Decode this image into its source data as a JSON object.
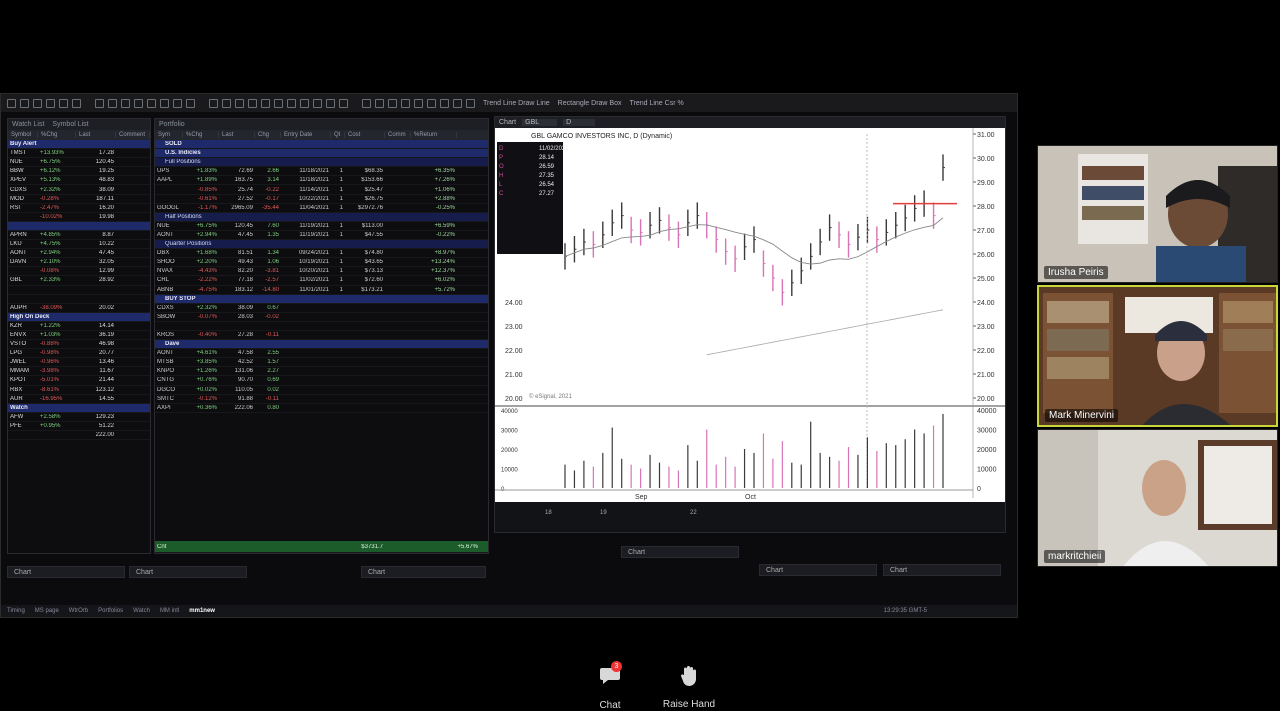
{
  "toolbar": {
    "tools": [
      "Trend Line Draw Line",
      "Rectangle Draw Box",
      "Trend Line Csr %"
    ]
  },
  "watchlist": {
    "tabs": [
      "Watch List",
      "Symbol List",
      "Portfolio"
    ],
    "columns": [
      "Symbol",
      "%Chg",
      "Last",
      "Comment"
    ],
    "groups": [
      {
        "title": "Buy Alert",
        "rows": [
          {
            "sym": "TMST",
            "pct": "+13.93%",
            "last": "17.28",
            "dir": "pos"
          },
          {
            "sym": "NUE",
            "pct": "+6.75%",
            "last": "120.45",
            "dir": "pos"
          },
          {
            "sym": "BBW",
            "pct": "+6.12%",
            "last": "19.25",
            "dir": "pos"
          },
          {
            "sym": "XPEV",
            "pct": "+5.13%",
            "last": "48.83",
            "dir": "pos"
          },
          {
            "sym": "CDXS",
            "pct": "+2.32%",
            "last": "38.09",
            "dir": "pos"
          },
          {
            "sym": "MOD",
            "pct": "-0.28%",
            "last": "187.11",
            "dir": "neg"
          },
          {
            "sym": "RSI",
            "pct": "-2.47%",
            "last": "16.20",
            "dir": "neg"
          },
          {
            "sym": "",
            "pct": "-10.02%",
            "last": "19.98",
            "dir": "neg"
          }
        ]
      },
      {
        "title": "",
        "rows": [
          {
            "sym": "APRN",
            "pct": "+4.85%",
            "last": "8.87",
            "dir": "pos"
          },
          {
            "sym": "LKU",
            "pct": "+4.75%",
            "last": "10.22",
            "dir": "pos"
          },
          {
            "sym": "AONT",
            "pct": "+2.94%",
            "last": "47.45",
            "dir": "pos"
          },
          {
            "sym": "DAVN",
            "pct": "+2.10%",
            "last": "32.05",
            "dir": "pos"
          },
          {
            "sym": "",
            "pct": "-0.08%",
            "last": "12.99",
            "dir": "neg"
          },
          {
            "sym": "GBL",
            "pct": "+2.33%",
            "last": "28.92",
            "dir": "pos"
          },
          {
            "sym": "",
            "pct": "",
            "last": "",
            "dir": "pos"
          },
          {
            "sym": "",
            "pct": "",
            "last": "",
            "dir": "pos"
          },
          {
            "sym": "AUPH",
            "pct": "-38.09%",
            "last": "20.02",
            "dir": "neg"
          }
        ]
      },
      {
        "title": "High On Deck",
        "rows": [
          {
            "sym": "KZR",
            "pct": "+1.22%",
            "last": "14.14",
            "dir": "pos"
          },
          {
            "sym": "ENVX",
            "pct": "+1.03%",
            "last": "36.19",
            "dir": "pos"
          },
          {
            "sym": "VSTO",
            "pct": "-0.88%",
            "last": "46.98",
            "dir": "neg"
          },
          {
            "sym": "LPG",
            "pct": "-0.98%",
            "last": "20.77",
            "dir": "neg"
          },
          {
            "sym": "JWEL",
            "pct": "-0.96%",
            "last": "13.46",
            "dir": "neg"
          },
          {
            "sym": "MMAM",
            "pct": "-3.98%",
            "last": "11.67",
            "dir": "neg"
          },
          {
            "sym": "KPOT",
            "pct": "-5.01%",
            "last": "21.44",
            "dir": "neg"
          },
          {
            "sym": "RBX",
            "pct": "-8.61%",
            "last": "123.12",
            "dir": "neg"
          },
          {
            "sym": "AUR",
            "pct": "-16.95%",
            "last": "14.55",
            "dir": "neg"
          }
        ]
      },
      {
        "title": "Watch",
        "rows": [
          {
            "sym": "AFW",
            "pct": "+2.58%",
            "last": "129.23",
            "dir": "pos"
          },
          {
            "sym": "PFE",
            "pct": "+0.95%",
            "last": "51.22",
            "dir": "pos"
          },
          {
            "sym": "",
            "pct": "",
            "last": "222.00",
            "dir": "pos"
          }
        ]
      }
    ]
  },
  "portfolio": {
    "columns": [
      "Sym",
      "%Chg",
      "Last",
      "Chg",
      "Entry Date",
      "Qt",
      "Cost",
      "Comm",
      "%Return"
    ],
    "sections": [
      {
        "title": "SOLD",
        "kind": "section",
        "rows": []
      },
      {
        "title": "U.S. Indicies",
        "kind": "section",
        "rows": []
      },
      {
        "title": "Full Positions",
        "kind": "subsection",
        "rows": [
          {
            "sym": "UPS",
            "pct": "+1.83%",
            "last": "72.69",
            "chg": "2.66",
            "date": "11/18/2021",
            "qty": "1",
            "cost": "$68.35",
            "ret": "+6.35%",
            "dir": "pos"
          },
          {
            "sym": "AAPL",
            "pct": "+1.89%",
            "last": "163.75",
            "chg": "3.14",
            "date": "11/18/2021",
            "qty": "1",
            "cost": "$153.66",
            "ret": "+7.26%",
            "dir": "pos"
          },
          {
            "sym": "",
            "pct": "-0.85%",
            "last": "25.74",
            "chg": "-0.22",
            "date": "11/14/2021",
            "qty": "1",
            "cost": "$25.47",
            "ret": "+1.06%",
            "dir": "neg"
          },
          {
            "sym": "",
            "pct": "-0.61%",
            "last": "27.52",
            "chg": "-0.17",
            "date": "10/22/2021",
            "qty": "1",
            "cost": "$26.75",
            "ret": "+2.88%",
            "dir": "neg"
          },
          {
            "sym": "GOOGL",
            "pct": "-1.17%",
            "last": "2965.09",
            "chg": "-35.44",
            "date": "11/04/2021",
            "qty": "1",
            "cost": "$2972.76",
            "ret": "-0.25%",
            "dir": "neg"
          }
        ]
      },
      {
        "title": "Half Positions",
        "kind": "subsection",
        "rows": [
          {
            "sym": "NUE",
            "pct": "+6.75%",
            "last": "120.45",
            "chg": "7.60",
            "date": "11/19/2021",
            "qty": "1",
            "cost": "$113.00",
            "ret": "+6.59%",
            "dir": "pos"
          },
          {
            "sym": "AONT",
            "pct": "+2.94%",
            "last": "47.45",
            "chg": "1.35",
            "date": "11/19/2021",
            "qty": "1",
            "cost": "$47.55",
            "ret": "-0.22%",
            "dir": "pos"
          }
        ]
      },
      {
        "title": "Quarter Positions",
        "kind": "subsection",
        "rows": [
          {
            "sym": "DBX",
            "pct": "+1.68%",
            "last": "81.51",
            "chg": "1.34",
            "date": "09/24/2021",
            "qty": "1",
            "cost": "$74.80",
            "ret": "+8.97%",
            "dir": "pos"
          },
          {
            "sym": "SHOO",
            "pct": "+2.20%",
            "last": "49.43",
            "chg": "1.06",
            "date": "10/19/2021",
            "qty": "1",
            "cost": "$43.65",
            "ret": "+13.24%",
            "dir": "pos"
          },
          {
            "sym": "NVAX",
            "pct": "-4.43%",
            "last": "82.20",
            "chg": "-3.81",
            "date": "10/20/2021",
            "qty": "1",
            "cost": "$73.13",
            "ret": "+12.37%",
            "dir": "neg"
          },
          {
            "sym": "CRL",
            "pct": "-2.22%",
            "last": "77.18",
            "chg": "-2.57",
            "date": "11/02/2021",
            "qty": "1",
            "cost": "$72.60",
            "ret": "+6.02%",
            "dir": "neg"
          },
          {
            "sym": "ABNB",
            "pct": "-4.75%",
            "last": "183.12",
            "chg": "-14.80",
            "date": "11/01/2021",
            "qty": "1",
            "cost": "$173.21",
            "ret": "+5.72%",
            "dir": "neg"
          }
        ]
      },
      {
        "title": "BUY STOP",
        "kind": "section",
        "rows": [
          {
            "sym": "CDXS",
            "pct": "+2.32%",
            "last": "38.09",
            "chg": "0.67",
            "date": "",
            "qty": "",
            "cost": "",
            "ret": "",
            "dir": "pos"
          },
          {
            "sym": "SBOW",
            "pct": "-0.07%",
            "last": "28.03",
            "chg": "-0.02",
            "date": "",
            "qty": "",
            "cost": "",
            "ret": "",
            "dir": "neg"
          },
          {
            "sym": "",
            "pct": "",
            "last": "",
            "chg": "",
            "date": "",
            "qty": "",
            "cost": "",
            "ret": "",
            "dir": "pos"
          },
          {
            "sym": "KROS",
            "pct": "-0.40%",
            "last": "27.28",
            "chg": "-0.11",
            "date": "",
            "qty": "",
            "cost": "",
            "ret": "",
            "dir": "neg"
          }
        ]
      },
      {
        "title": "Dave",
        "kind": "section",
        "rows": [
          {
            "sym": "AONT",
            "pct": "+4.61%",
            "last": "47.58",
            "chg": "2.55",
            "date": "",
            "qty": "",
            "cost": "",
            "ret": "",
            "dir": "pos"
          },
          {
            "sym": "MTSB",
            "pct": "+3.85%",
            "last": "42.52",
            "chg": "1.57",
            "date": "",
            "qty": "",
            "cost": "",
            "ret": "",
            "dir": "pos"
          },
          {
            "sym": "KNPO",
            "pct": "+1.26%",
            "last": "131.06",
            "chg": "2.27",
            "date": "",
            "qty": "",
            "cost": "",
            "ret": "",
            "dir": "pos"
          },
          {
            "sym": "CNTG",
            "pct": "+0.76%",
            "last": "90.70",
            "chg": "0.69",
            "date": "",
            "qty": "",
            "cost": "",
            "ret": "",
            "dir": "pos"
          },
          {
            "sym": "DGCO",
            "pct": "+0.02%",
            "last": "110.05",
            "chg": "0.02",
            "date": "",
            "qty": "",
            "cost": "",
            "ret": "",
            "dir": "pos"
          },
          {
            "sym": "SMTC",
            "pct": "-0.12%",
            "last": "91.88",
            "chg": "-0.11",
            "date": "",
            "qty": "",
            "cost": "",
            "ret": "",
            "dir": "neg"
          },
          {
            "sym": "AXPI",
            "pct": "+0.36%",
            "last": "222.06",
            "chg": "0.80",
            "date": "",
            "qty": "",
            "cost": "",
            "ret": "",
            "dir": "pos"
          }
        ]
      }
    ],
    "footer": {
      "label": "Cnt",
      "total": "$3731.7",
      "ret": "+5.67%"
    }
  },
  "chart": {
    "tab_label": "Chart",
    "symbol": "GBL",
    "interval": "D",
    "title": "GBL GAMCO INVESTORS INC, D (Dynamic)",
    "date": "11/02/2021",
    "ohlc": [
      {
        "k": "D",
        "v": "11/02/2021"
      },
      {
        "k": "P",
        "v": "28.14"
      },
      {
        "k": "O",
        "v": "26.59"
      },
      {
        "k": "H",
        "v": "27.35"
      },
      {
        "k": "L",
        "v": "26.54"
      },
      {
        "k": "C",
        "v": "27.27"
      }
    ],
    "copyright": "© eSignal, 2021",
    "price_axis": [
      "31.00",
      "30.00",
      "29.00",
      "28.00",
      "27.00",
      "26.00",
      "25.00",
      "24.00",
      "23.00",
      "22.00",
      "21.00",
      "20.00"
    ],
    "left_labels": [
      "24.00",
      "23.00",
      "22.00",
      "21.00",
      "20.00"
    ],
    "volume_axis": [
      "40000",
      "30000",
      "20000",
      "10000",
      "0"
    ],
    "month_labels": [
      "Sep",
      "Oct"
    ],
    "day_labels": [
      "18",
      "19",
      "22"
    ],
    "colors": {
      "up": "#3a3a3a",
      "down": "#d873b8",
      "ma": "#888888",
      "marker": "#e23d3d"
    }
  },
  "chart_data": {
    "type": "bar",
    "title": "GBL GAMCO INVESTORS INC, D (Dynamic)",
    "ylim": [
      20,
      31
    ],
    "series": [
      {
        "name": "price",
        "values": [
          25.9,
          26.2,
          26.5,
          26.4,
          26.8,
          27.3,
          27.6,
          27.0,
          26.9,
          27.2,
          27.4,
          27.1,
          26.8,
          27.3,
          27.6,
          27.2,
          26.6,
          26.1,
          25.8,
          26.3,
          26.6,
          25.6,
          25.0,
          24.4,
          24.8,
          25.3,
          25.9,
          26.5,
          27.1,
          26.8,
          26.4,
          26.7,
          27.0,
          26.6,
          26.9,
          27.2,
          27.5,
          27.9,
          28.1,
          27.6,
          29.6
        ]
      }
    ],
    "volume_ylim": [
      0,
      40000
    ],
    "volume": [
      12000,
      9000,
      14000,
      11000,
      18000,
      31000,
      15000,
      12000,
      10000,
      17000,
      13000,
      11000,
      9000,
      22000,
      14000,
      30000,
      12000,
      16000,
      11000,
      20000,
      18000,
      28000,
      15000,
      24000,
      13000,
      12000,
      34000,
      18000,
      16000,
      14000,
      21000,
      17000,
      26000,
      19000,
      23000,
      22000,
      25000,
      30000,
      28000,
      32000,
      38000
    ]
  },
  "mini_panels": [
    "Chart",
    "Chart",
    "Chart",
    "Chart",
    "Chart",
    "Chart"
  ],
  "status_bar": {
    "tabs": [
      "Timing",
      "MS page",
      "WtrOrb",
      "Portfolios",
      "Watch",
      "MM intl",
      "mm1new"
    ],
    "active": "mm1new",
    "clock": "13:29:35 GMT-5"
  },
  "participants": [
    {
      "name": "Irusha Peiris"
    },
    {
      "name": "Mark Minervini"
    },
    {
      "name": "markritchieii"
    }
  ],
  "meeting_controls": {
    "chat_label": "Chat",
    "chat_badge": "3",
    "raise_hand_label": "Raise Hand"
  }
}
